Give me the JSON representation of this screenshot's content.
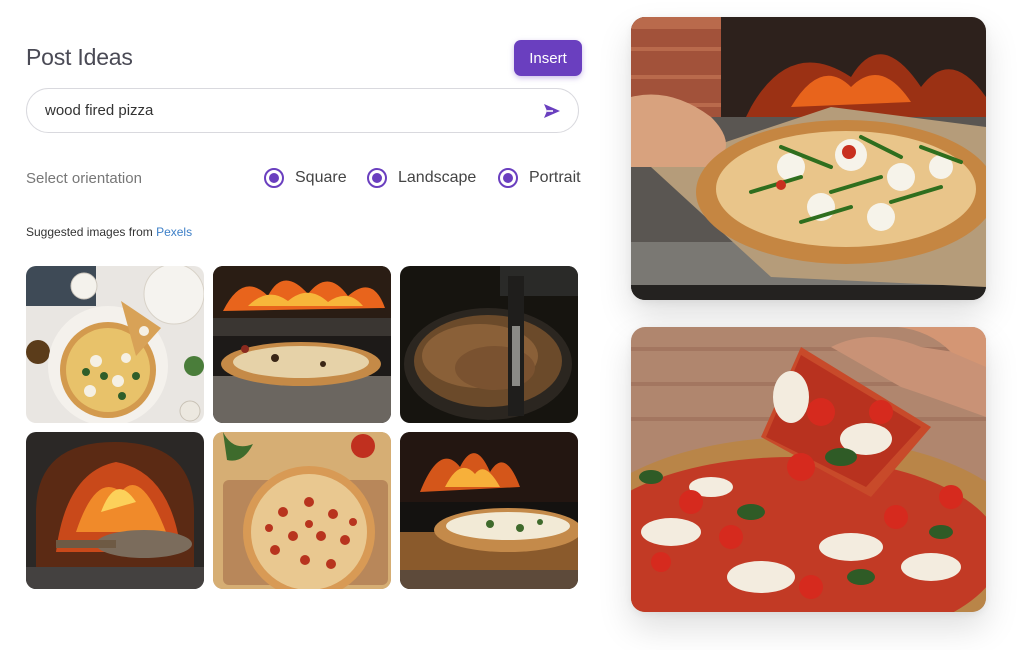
{
  "header": {
    "title": "Post Ideas",
    "insert_label": "Insert"
  },
  "search": {
    "value": "wood fired pizza",
    "send_icon": "send-icon"
  },
  "orientation": {
    "label": "Select orientation",
    "options": [
      {
        "label": "Square",
        "selected": true
      },
      {
        "label": "Landscape",
        "selected": true
      },
      {
        "label": "Portrait",
        "selected": true
      }
    ]
  },
  "suggestions": {
    "prefix": "Suggested images from ",
    "source": "Pexels"
  },
  "colors": {
    "accent": "#6a3fbf",
    "link": "#3d7fc7"
  }
}
